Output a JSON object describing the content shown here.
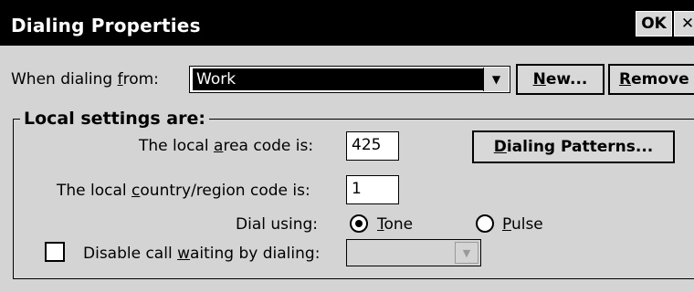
{
  "window": {
    "title": "Dialing Properties",
    "ok_label": "OK",
    "close_label": "✕"
  },
  "dialing_from": {
    "label_prefix": "When dialing ",
    "label_accel": "f",
    "label_suffix": "rom:",
    "selected": "Work",
    "new_accel": "N",
    "new_rest": "ew...",
    "remove_accel": "R",
    "remove_rest": "emove"
  },
  "local_settings": {
    "title": "Local settings are:",
    "area_code_prefix": "The local ",
    "area_code_accel": "a",
    "area_code_suffix": "rea code is:",
    "area_code_value": "425",
    "country_prefix": "The local ",
    "country_accel": "c",
    "country_suffix": "ountry/region code is:",
    "country_value": "1",
    "dialing_patterns_accel": "D",
    "dialing_patterns_rest": "ialing Patterns...",
    "dial_using_label": "Dial using:",
    "tone_accel": "T",
    "tone_rest": "one",
    "pulse_accel": "P",
    "pulse_rest": "ulse",
    "tone_selected": true,
    "call_waiting_prefix": "Disable call ",
    "call_waiting_accel": "w",
    "call_waiting_suffix": "aiting by dialing:",
    "call_waiting_checked": false,
    "call_waiting_value": ""
  },
  "icons": {
    "dropdown": "chevron-down-icon",
    "close": "close-icon"
  }
}
